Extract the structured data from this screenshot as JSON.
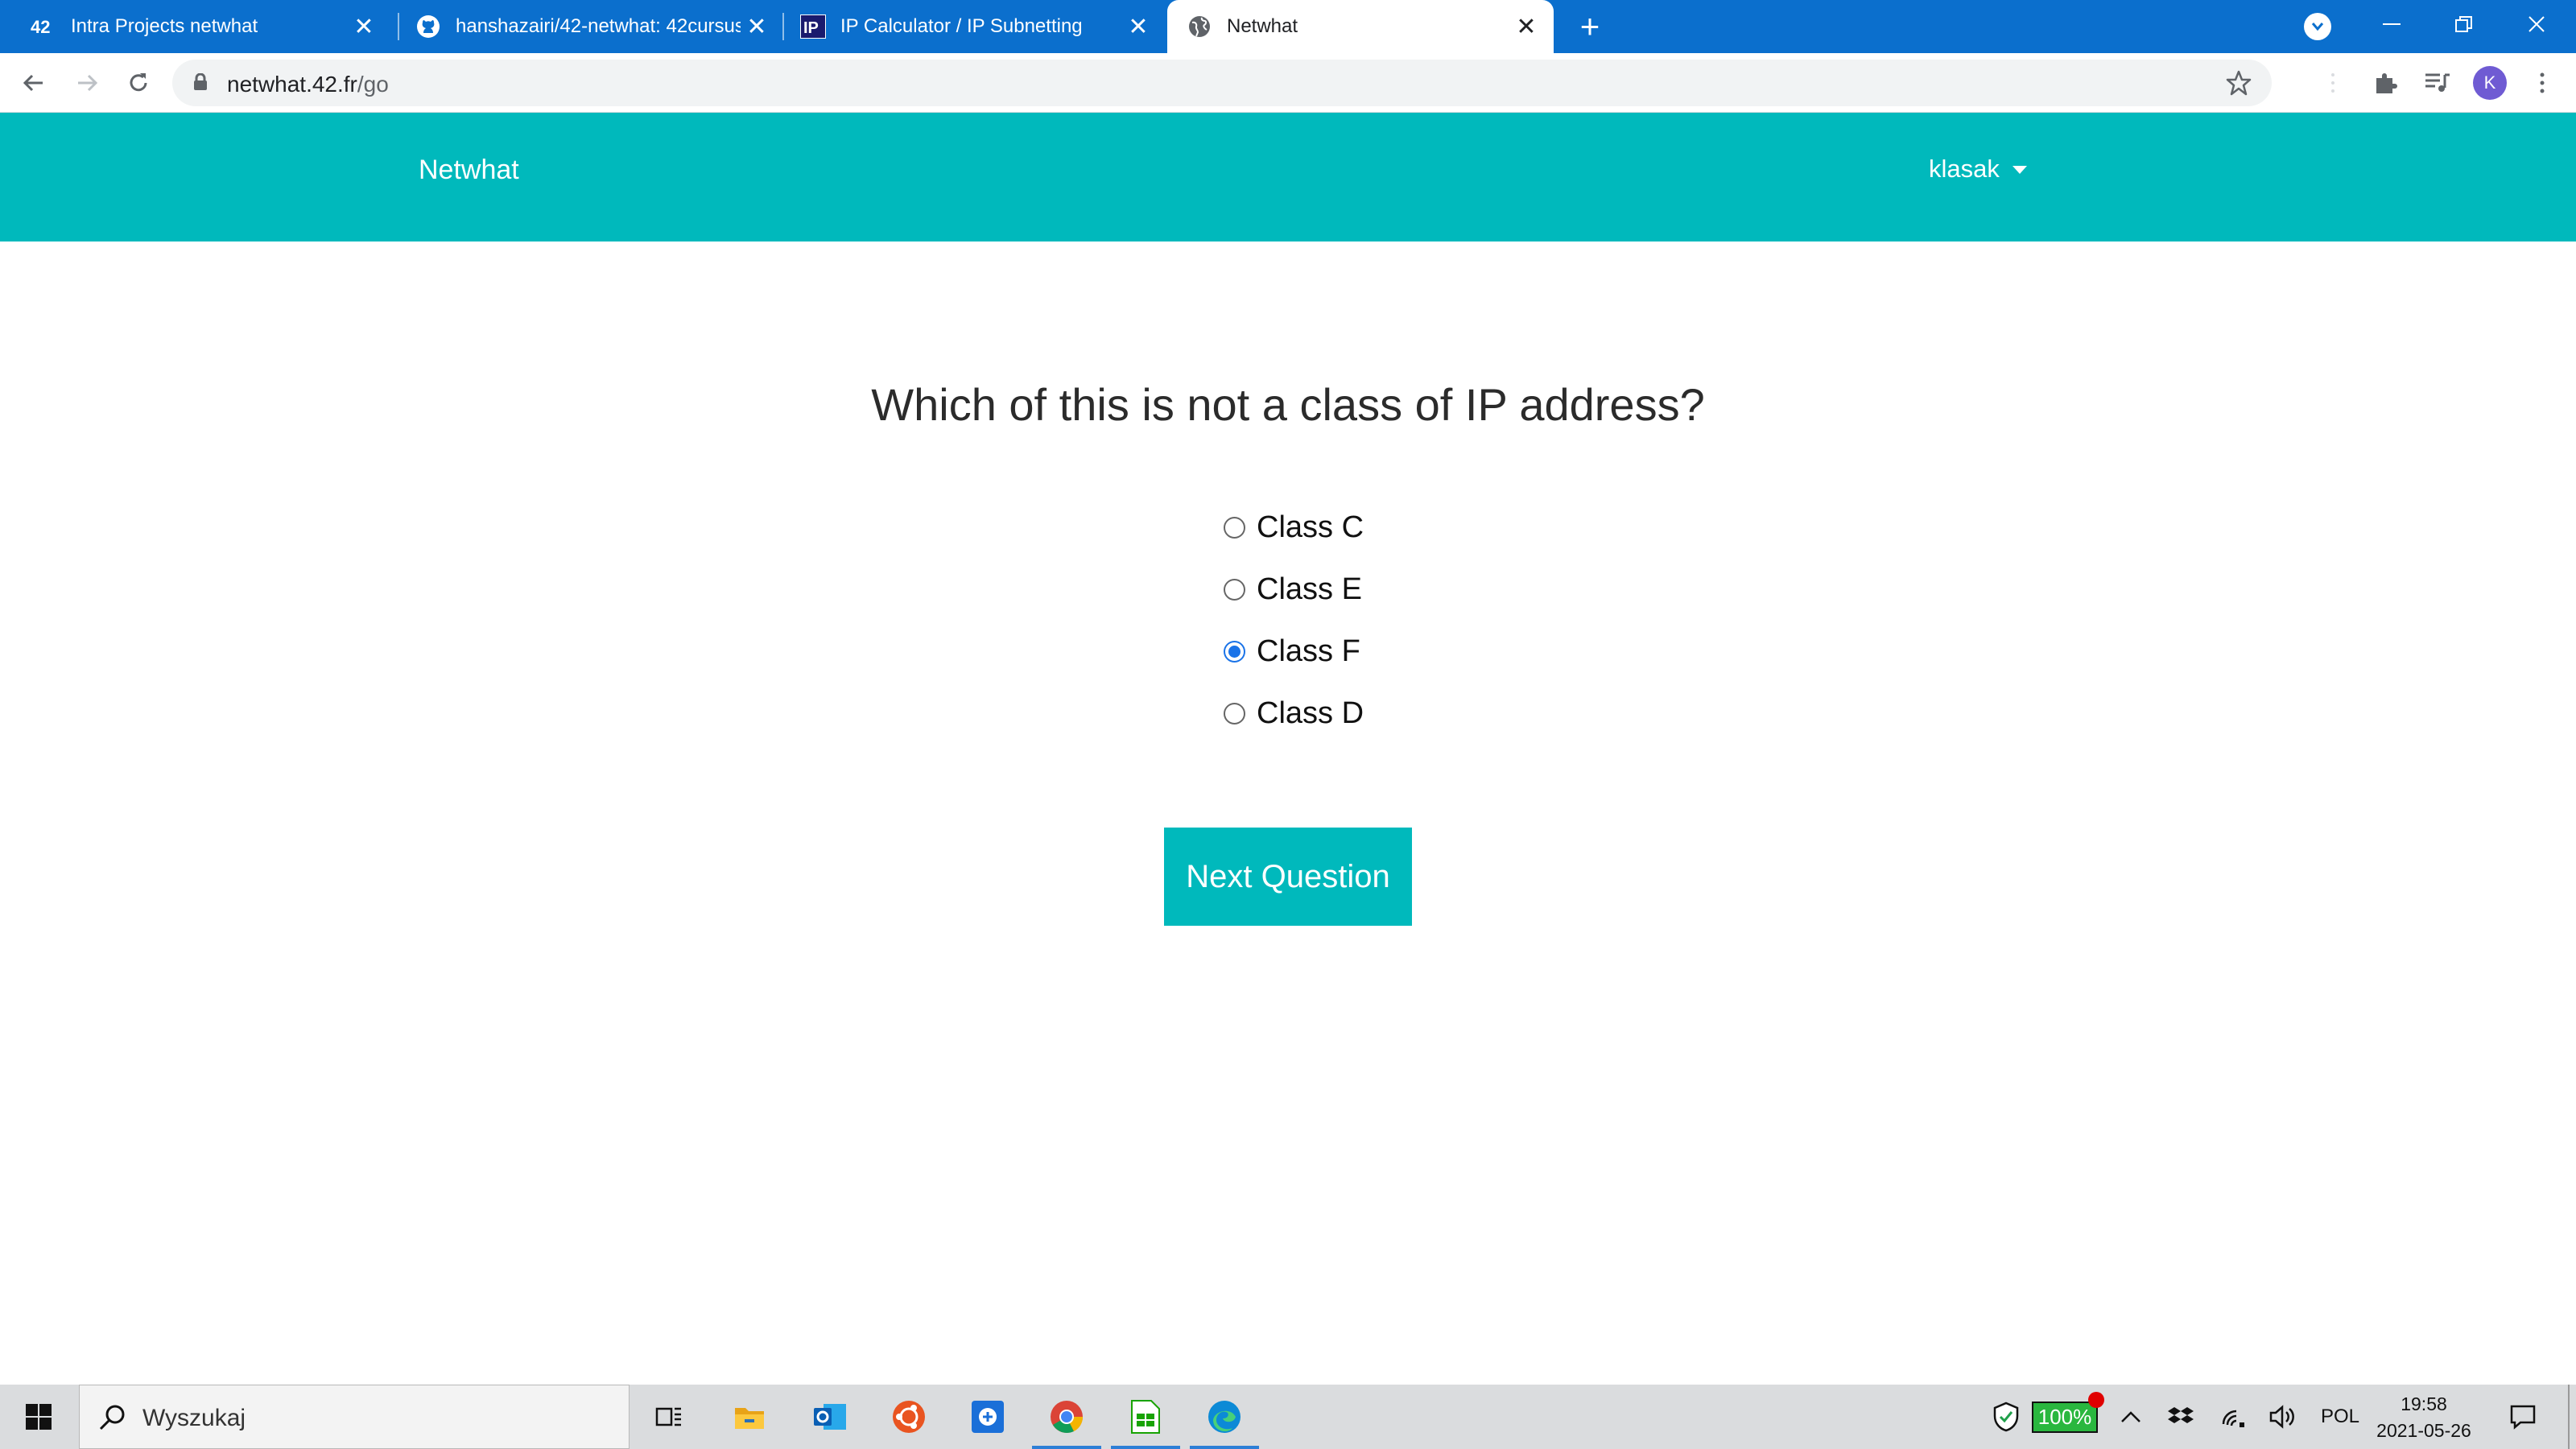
{
  "browser": {
    "tabs": [
      {
        "title": "Intra Projects netwhat",
        "active": false,
        "icon": "42-logo-icon"
      },
      {
        "title": "hanshazairi/42-netwhat: 42cursus",
        "active": false,
        "icon": "github-icon"
      },
      {
        "title": "IP Calculator / IP Subnetting",
        "active": false,
        "icon": "ip-calculator-icon"
      },
      {
        "title": "Netwhat",
        "active": true,
        "icon": "globe-icon"
      }
    ],
    "url_host": "netwhat.42.fr",
    "url_path": "/go",
    "profile_initial": "K"
  },
  "page": {
    "brand": "Netwhat",
    "user": "klasak",
    "question": "Which of this is not a class of IP address?",
    "options": [
      {
        "label": "Class C",
        "checked": false
      },
      {
        "label": "Class E",
        "checked": false
      },
      {
        "label": "Class F",
        "checked": true
      },
      {
        "label": "Class D",
        "checked": false
      }
    ],
    "next_button": "Next Question",
    "accent_color": "#00b9bc"
  },
  "taskbar": {
    "search_placeholder": "Wyszukaj",
    "battery": "100%",
    "language": "POL",
    "time": "19:58",
    "date": "2021-05-26"
  }
}
